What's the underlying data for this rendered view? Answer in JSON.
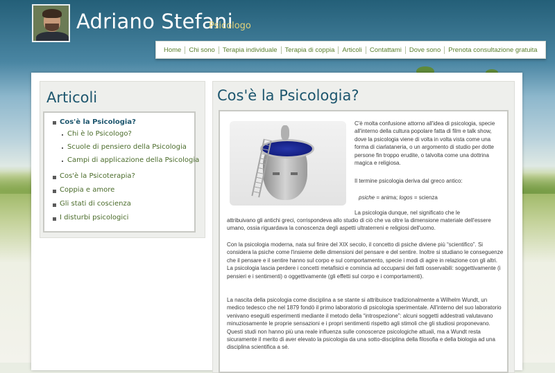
{
  "header": {
    "title": "Adriano Stefani",
    "subtitle": "Psicologo"
  },
  "nav": {
    "items": [
      "Home",
      "Chi sono",
      "Terapia individuale",
      "Terapia di coppia",
      "Articoli",
      "Contattami",
      "Dove sono",
      "Prenota consultazione gratuita"
    ]
  },
  "sidebar": {
    "title": "Articoli",
    "items": [
      {
        "label": "Cos'è la Psicologia?",
        "active": true
      },
      {
        "label": "Chi è lo Psicologo?"
      },
      {
        "label": "Scuole di pensiero della Psicologia"
      },
      {
        "label": "Campi di applicazione della Psicologia"
      },
      {
        "label": "Cos'è la Psicoterapia?"
      },
      {
        "label": "Coppia e amore"
      },
      {
        "label": "Gli stati di coscienza"
      },
      {
        "label": "I disturbi psicologici"
      }
    ]
  },
  "article": {
    "title": "Cos'è la Psicologia?",
    "p1": "C'è molta confusione attorno all'idea di psicologia, specie all'interno della cultura popolare fatta di film e talk show, dove la psicologia viene di volta in volta vista come una forma di ciarlataneria, o un argomento di studio per dotte persone fin troppo erudite, o talvolta come una dottrina magica e religiosa.",
    "p2": "Il termine psicologia deriva dal greco antico:",
    "greek": {
      "term1": "psiche",
      "def1": " = anima; ",
      "term2": "logos",
      "def2": " = scienza"
    },
    "p3a": "La psicologia dunque, nel significato che le",
    "p3b": "attribuivano gli antichi greci, corrispondeva allo studio di ciò che va oltre la dimensione materiale dell'essere umano, ossia riguardava la conoscenza degli aspetti ultraterreni e religiosi dell'uomo.",
    "p4": "Con la psicologia moderna, nata sul finire del XIX secolo, il concetto di psiche diviene più “scientifico”. Si considera la psiche come l'insieme delle dimensioni del pensare e del sentire. Inoltre si studiano le conseguenze che il pensare e il sentire hanno sul corpo e sul comportamento, specie i modi di agire in relazione con gli altri. La psicologia lascia perdere i concetti metafisici e comincia ad occuparsi dei fatti osservabili: soggettivamente (i pensieri e i sentimenti) o oggettivamente (gli effetti sul corpo e i comportamenti).",
    "p5": "La nascita della psicologia come disciplina a se stante si attribuisce tradizionalmente a Wilhelm Wundt, un medico tedesco che nel 1879 fondò il primo laboratorio di psicologia sperimentale. All'interno del suo laboratorio venivano eseguiti esperimenti mediante il metodo della “introspezione”: alcuni soggetti addestrati valutavano minuziosamente le proprie sensazioni e i propri sentimenti rispetto agli stimoli che gli studiosi proponevano. Questi studi non hanno più una reale influenza sulle conoscenze psicologiche attuali, ma a Wundt resta sicuramente il merito di aver elevato la psicologia da una sotto-disciplina della filosofia e della biologia ad una disciplina scientifica a sé."
  },
  "colors": {
    "title_blue": "#1d566e",
    "link_green": "#5a7f2d",
    "subtitle_gold": "#e3d27a"
  }
}
